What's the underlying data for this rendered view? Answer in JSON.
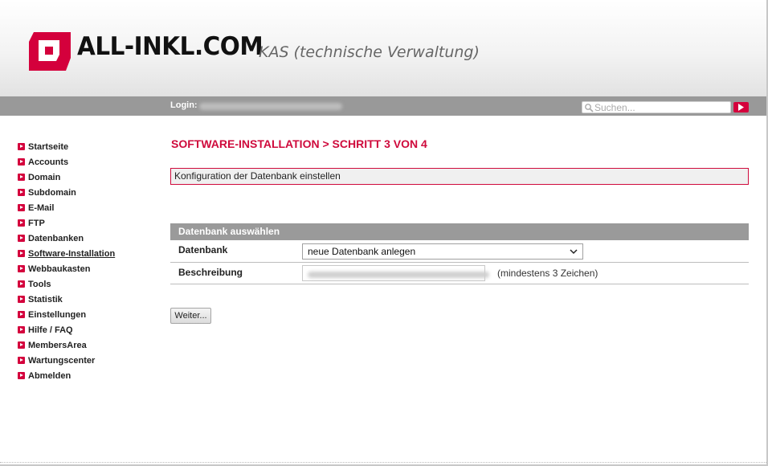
{
  "header": {
    "brand": "ALL-INKL.COM",
    "subtitle": "KAS (technische Verwaltung)",
    "brand_color": "#d4003c"
  },
  "topbar": {
    "login_label": "Login:",
    "search_placeholder": "Suchen..."
  },
  "sidebar": {
    "items": [
      {
        "label": "Startseite"
      },
      {
        "label": "Accounts"
      },
      {
        "label": "Domain"
      },
      {
        "label": "Subdomain"
      },
      {
        "label": "E-Mail"
      },
      {
        "label": "FTP"
      },
      {
        "label": "Datenbanken"
      },
      {
        "label": "Software-Installation",
        "active": true
      },
      {
        "label": "Webbaukasten"
      },
      {
        "label": "Tools"
      },
      {
        "label": "Statistik"
      },
      {
        "label": "Einstellungen"
      },
      {
        "label": "Hilfe / FAQ"
      },
      {
        "label": "MembersArea"
      },
      {
        "label": "Wartungscenter"
      },
      {
        "label": "Abmelden"
      }
    ]
  },
  "main": {
    "title": "SOFTWARE-INSTALLATION > SCHRITT 3 VON 4",
    "info": "Konfiguration der Datenbank einstellen",
    "section_title": "Datenbank auswählen",
    "fields": {
      "db_label": "Datenbank",
      "db_selected": "neue Datenbank anlegen",
      "desc_label": "Beschreibung",
      "desc_hint": "(mindestens 3 Zeichen)"
    },
    "next_button": "Weiter..."
  },
  "colors": {
    "accent": "#cf0a3c",
    "bar_gray": "#999999",
    "section_gray": "#9a9a9a"
  }
}
